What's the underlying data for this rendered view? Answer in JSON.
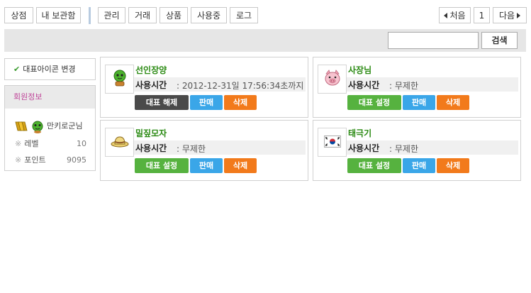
{
  "toolbar": {
    "shop": "상점",
    "my_storage": "내 보관함",
    "manage": "관리",
    "trade": "거래",
    "product": "상품",
    "in_use": "사용중",
    "log": "로그"
  },
  "pagination": {
    "first": "처음",
    "current": "1",
    "next": "다음"
  },
  "search": {
    "placeholder": "",
    "button": "검색"
  },
  "left_panel": {
    "change_icon_button": "대표아이콘 변경",
    "member_info_title": "회원정보",
    "username": "만키로군님",
    "level_label": "레벨",
    "level_value": "10",
    "points_label": "포인트",
    "points_value": "9095",
    "bullet": "※"
  },
  "items": [
    {
      "name": "선인장양",
      "usage_label": "사용시간",
      "usage_value": ": 2012-12-31일 17:56:34초까지",
      "rep_button": "대표 해제",
      "sell_button": "판매",
      "delete_button": "삭제",
      "icon": "cactus-icon"
    },
    {
      "name": "사장님",
      "usage_label": "사용시간",
      "usage_value": ": 무제한",
      "rep_button": "대표 설정",
      "sell_button": "판매",
      "delete_button": "삭제",
      "icon": "pig-icon"
    },
    {
      "name": "밀짚모자",
      "usage_label": "사용시간",
      "usage_value": ": 무제한",
      "rep_button": "대표 설정",
      "sell_button": "판매",
      "delete_button": "삭제",
      "icon": "straw-hat-icon"
    },
    {
      "name": "태극기",
      "usage_label": "사용시간",
      "usage_value": ": 무제한",
      "rep_button": "대표 설정",
      "sell_button": "판매",
      "delete_button": "삭제",
      "icon": "korea-flag-icon"
    }
  ],
  "colors": {
    "item_name": "#2a8a12",
    "rep_unset": "#4a4a4a",
    "rep_set": "#56b23f",
    "sell": "#3aa6e8",
    "delete": "#f27a1b",
    "member_title": "#c0479a"
  }
}
